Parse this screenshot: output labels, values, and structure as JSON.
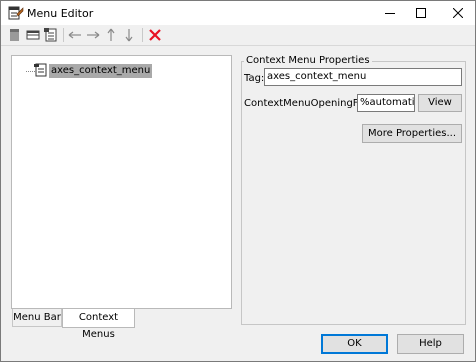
{
  "window": {
    "title": "Menu Editor",
    "app_icon": "menu-editor-icon",
    "controls": [
      "minimize-icon",
      "maximize-icon",
      "close-icon"
    ]
  },
  "toolbar": {
    "buttons": [
      "new-menu-icon",
      "new-menu-item-icon",
      "new-context-menu-icon",
      "move-left-icon",
      "move-right-icon",
      "move-up-icon",
      "move-down-icon",
      "delete-icon"
    ],
    "delete_color": "#e81123"
  },
  "tree": {
    "items": [
      {
        "label": "axes_context_menu",
        "selected": true
      }
    ],
    "selection_color": "#a9a9a9"
  },
  "tabs": [
    {
      "label": "Menu Bar",
      "active": false
    },
    {
      "label": "Context Menus",
      "active": true
    }
  ],
  "properties": {
    "group_title": "Context Menu Properties",
    "tag_label": "Tag:",
    "tag_value": "axes_context_menu",
    "opening_fcn_label": "ContextMenuOpeningFcn:",
    "opening_fcn_value": "%automatic",
    "view_button": "View",
    "more_properties_button": "More Properties..."
  },
  "footer": {
    "ok_button": "OK",
    "help_button": "Help",
    "accent_color": "#0078d7"
  }
}
